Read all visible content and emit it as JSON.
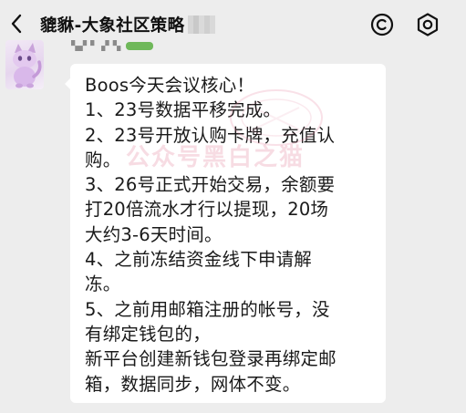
{
  "header": {
    "title": "貔貅-大象社区策略",
    "back_icon": "chevron-left-icon",
    "actions": [
      {
        "icon": "circle-c-icon"
      },
      {
        "icon": "settings-ring-icon"
      }
    ]
  },
  "message": {
    "lines": [
      "Boos今天会议核心！",
      "1、23号数据平移完成。",
      "2、23号开放认购卡牌，充值认",
      "购。",
      "3、26号正式开始交易，余额要",
      "打20倍流水才行以提现，20场",
      "大约3-6天时间。",
      "4、之前冻结资金线下申请解",
      "冻。",
      "5、之前用邮箱注册的帐号，没",
      "有绑定钱包的，",
      "新平台创建新钱包登录再绑定邮",
      "箱，数据同步，网体不变。"
    ]
  },
  "watermark": {
    "text": "公众号黑白之猫"
  },
  "colors": {
    "background": "#ededed",
    "bubble": "#ffffff",
    "watermark": "#e27694"
  }
}
